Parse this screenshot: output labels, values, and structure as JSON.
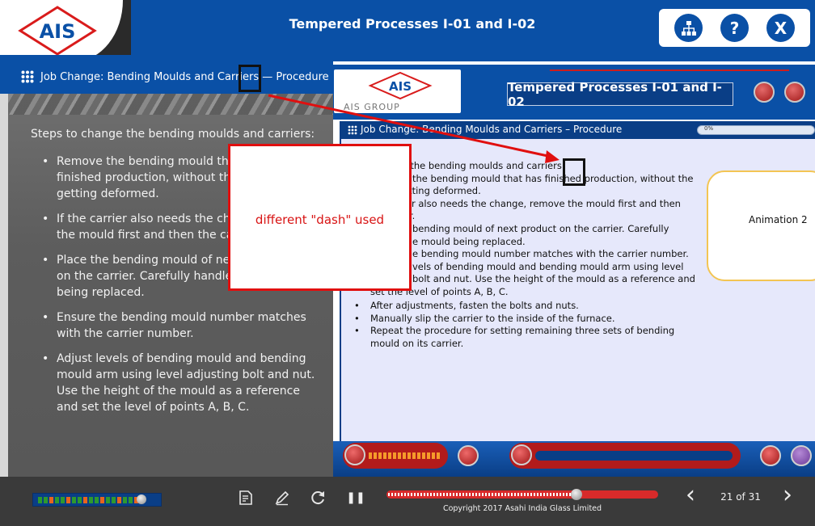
{
  "header": {
    "logo_text": "AIS",
    "title": "Tempered Processes I-01 and I-02",
    "actions": [
      {
        "name": "sitemap-icon"
      },
      {
        "name": "help-icon",
        "glyph": "?"
      },
      {
        "name": "close-icon",
        "glyph": "X"
      }
    ]
  },
  "slide": {
    "heading": "Job Change: Bending Moulds and Carriers — Procedure",
    "steps_title": "Steps to change the bending moulds and carriers:",
    "steps": [
      "Remove the bending mould that has finished production, without the mould getting deformed.",
      "If the carrier also needs the change, remove the mould first and then the carrier.",
      "Place the bending mould of next product on the carrier. Carefully handle the mould being replaced.",
      "Ensure the bending mould number matches with the carrier number.",
      "Adjust levels of bending mould and bending mould arm using level adjusting bolt and nut. Use the height of the mould as a reference and set the level of points A, B, C."
    ],
    "visible_steps": [
      "Remove the bending mould th",
      "finished production, without th",
      "getting deformed.",
      "If the carrier also needs the cha",
      "the mould first and then the ca",
      "Place the bending mould of ne",
      "on the carrier. Carefully handle",
      "being replaced.",
      "Ensure the bending mould number matches",
      "with the carrier number.",
      "Adjust levels of bending mould and bending",
      "mould arm using level adjusting bolt and nut.",
      "Use the height of the mould as a reference",
      "and set the level of points A, B, C."
    ]
  },
  "reference": {
    "logo_text": "AIS",
    "logo_group": "AIS GROUP",
    "title": "Tempered Processes  I-01 and I-02",
    "strip_title": "Job Change: Bending Moulds and Carriers – Procedure",
    "progress_label": "0%",
    "text_lines": [
      "nge the bending moulds and carriers:",
      "the bending mould that has finished production, without the",
      "etting deformed.",
      "rier also needs the change, remove the mould first and then",
      "r.",
      "bending mould of next product on the carrier. Carefully",
      "e mould being replaced.",
      "e bending mould number matches with the carrier number.",
      "vels of bending mould and bending mould arm using level",
      "bolt and nut. Use the height of the mould as a reference and",
      "set the level of points A, B, C."
    ],
    "list_items": [
      "After adjustments, fasten the bolts and nuts.",
      "Manually slip the carrier to the inside of the furnace.",
      "Repeat the procedure for setting remaining three sets of bending mould on its carrier."
    ],
    "animation_label": "Animation 2"
  },
  "callout": {
    "text": "different \"dash\" used"
  },
  "player": {
    "progress_percent": 70,
    "volume_percent": 90,
    "copyright": "Copyright 2017 Asahi India Glass Limited",
    "page_info": "21 of 31",
    "prev_glyph": "‹",
    "next_glyph": "›",
    "pause_glyph": "❚❚"
  },
  "colors": {
    "brand_blue": "#0a50a6",
    "dark_blue": "#0a3e86",
    "accent_red": "#e00f0f",
    "panel_gray": "#5d5d5d"
  }
}
